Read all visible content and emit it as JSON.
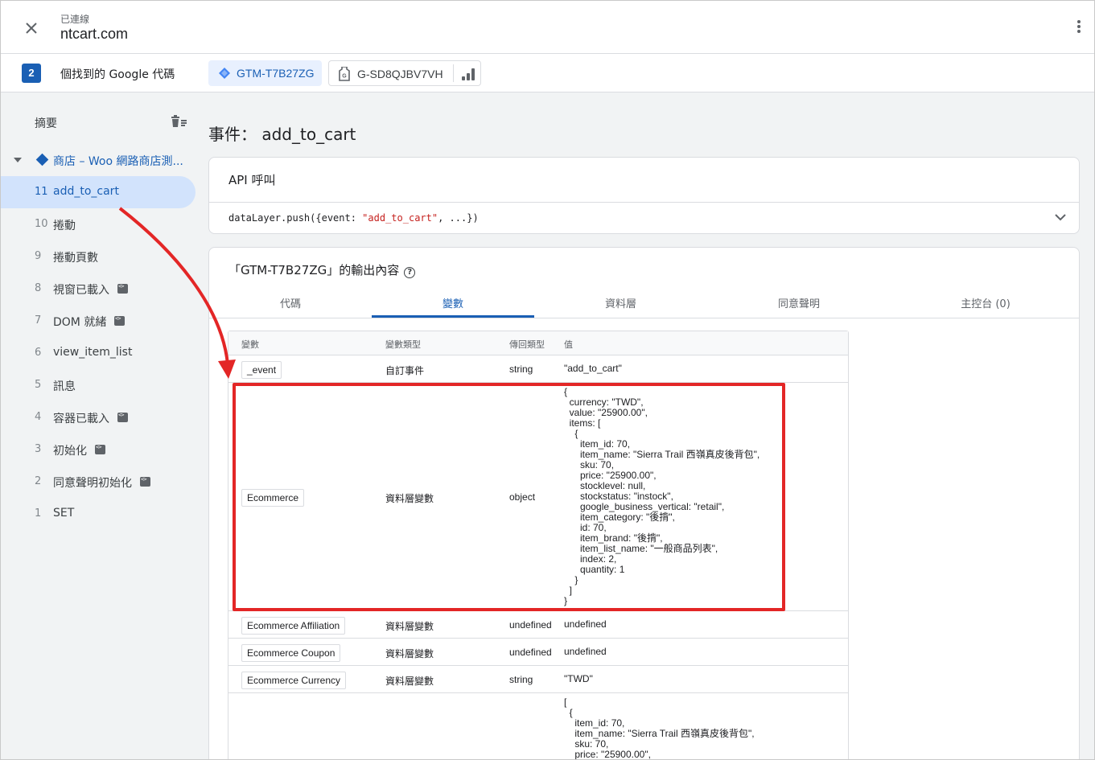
{
  "header": {
    "connection_status": "已連線",
    "host": "ntcart.com"
  },
  "tagbar": {
    "count": "2",
    "found_label": "個找到的 Google 代碼",
    "gtm_container": "GTM-T7B27ZG",
    "ga_tag": "G-SD8QJBV7VH"
  },
  "sidebar": {
    "summary_label": "摘要",
    "page_title": "商店 – Woo 網路商店測...",
    "events": [
      {
        "num": "11",
        "name": "add_to_cart",
        "selected": true,
        "code_badge": false
      },
      {
        "num": "10",
        "name": "捲動",
        "code_badge": false
      },
      {
        "num": "9",
        "name": "捲動頁數",
        "code_badge": false
      },
      {
        "num": "8",
        "name": "視窗已載入",
        "code_badge": true
      },
      {
        "num": "7",
        "name": "DOM 就緒",
        "code_badge": true
      },
      {
        "num": "6",
        "name": "view_item_list",
        "code_badge": false
      },
      {
        "num": "5",
        "name": "訊息",
        "code_badge": false
      },
      {
        "num": "4",
        "name": "容器已載入",
        "code_badge": true
      },
      {
        "num": "3",
        "name": "初始化",
        "code_badge": true
      },
      {
        "num": "2",
        "name": "同意聲明初始化",
        "code_badge": true
      },
      {
        "num": "1",
        "name": "SET",
        "code_badge": false
      }
    ]
  },
  "main": {
    "title": "事件： add_to_cart",
    "api": {
      "title": "API 呼叫",
      "code_prefix": "dataLayer.push({event: ",
      "code_event": "\"add_to_cart\"",
      "code_suffix": ", ...})"
    },
    "output": {
      "title": "「GTM-T7B27ZG」的輸出內容",
      "tabs": [
        "代碼",
        "變數",
        "資料層",
        "同意聲明",
        "主控台 (0)"
      ],
      "active_tab": "變數",
      "columns": [
        "變數",
        "變數類型",
        "傳回類型",
        "值"
      ],
      "rows": [
        {
          "name": "_event",
          "type": "自訂事件",
          "return": "string",
          "value": "\"add_to_cart\""
        },
        {
          "name": "Ecommerce",
          "type": "資料層變數",
          "return": "object",
          "value": "{\n  currency: \"TWD\",\n  value: \"25900.00\",\n  items: [\n    {\n      item_id: 70,\n      item_name: \"Sierra Trail 西嶺真皮後背包\",\n      sku: 70,\n      price: \"25900.00\",\n      stocklevel: null,\n      stockstatus: \"instock\",\n      google_business_vertical: \"retail\",\n      item_category: \"後揹\",\n      id: 70,\n      item_brand: \"後揹\",\n      item_list_name: \"一般商品列表\",\n      index: 2,\n      quantity: 1\n    }\n  ]\n}"
        },
        {
          "name": "Ecommerce Affiliation",
          "type": "資料層變數",
          "return": "undefined",
          "value": "undefined"
        },
        {
          "name": "Ecommerce Coupon",
          "type": "資料層變數",
          "return": "undefined",
          "value": "undefined"
        },
        {
          "name": "Ecommerce Currency",
          "type": "資料層變數",
          "return": "string",
          "value": "\"TWD\""
        },
        {
          "name": "",
          "type": "",
          "return": "",
          "value": "[\n  {\n    item_id: 70,\n    item_name: \"Sierra Trail 西嶺真皮後背包\",\n    sku: 70,\n    price: \"25900.00\","
        }
      ]
    }
  },
  "colors": {
    "accent": "#1a5fb4",
    "selected_bg": "#d2e3fc",
    "highlight": "#e32626"
  }
}
